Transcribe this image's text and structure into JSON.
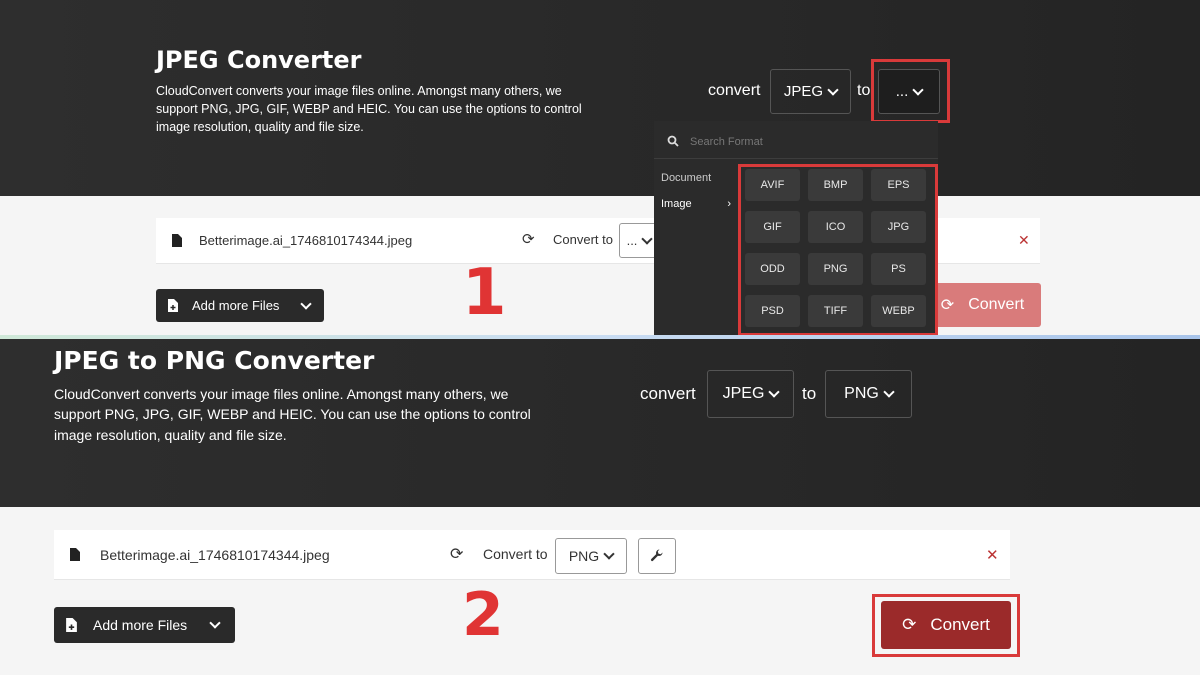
{
  "colors": {
    "accent_red": "#d93a3a",
    "convert_bg": "#9b2a2a",
    "panel_dark": "#2a2a2a"
  },
  "top": {
    "title": "JPEG Converter",
    "desc": [
      "CloudConvert converts your image files online. Amongst many others, we",
      "support PNG, JPG, GIF, WEBP and HEIC. You can use the options to control",
      "image resolution, quality and file size."
    ],
    "convert_label": "convert",
    "from_value": "JPEG",
    "to_label": "to",
    "to_value": "...",
    "file_name": "Betterimage.ai_1746810174344.jpeg",
    "convert_to_label": "Convert to",
    "convert_to_value": "...",
    "add_files": "Add more Files",
    "convert_button": "Convert",
    "step": "1",
    "dropdown": {
      "search_placeholder": "Search Format",
      "categories": [
        "Document",
        "Image"
      ],
      "formats": [
        "AVIF",
        "BMP",
        "EPS",
        "GIF",
        "ICO",
        "JPG",
        "ODD",
        "PNG",
        "PS",
        "PSD",
        "TIFF",
        "WEBP"
      ]
    }
  },
  "bottom": {
    "title": "JPEG to PNG Converter",
    "desc": [
      "CloudConvert converts your image files online. Amongst many others, we",
      "support PNG, JPG, GIF, WEBP and HEIC. You can use the options to control",
      "image resolution, quality and file size."
    ],
    "convert_label": "convert",
    "from_value": "JPEG",
    "to_label": "to",
    "to_value": "PNG",
    "file_name": "Betterimage.ai_1746810174344.jpeg",
    "convert_to_label": "Convert to",
    "convert_to_value": "PNG",
    "add_files": "Add more Files",
    "convert_button": "Convert",
    "step": "2"
  },
  "icons": {
    "file": "file-icon",
    "refresh": "refresh-icon",
    "close": "close-icon",
    "wrench": "wrench-icon",
    "search": "search-icon",
    "add_file": "add-file-icon"
  }
}
